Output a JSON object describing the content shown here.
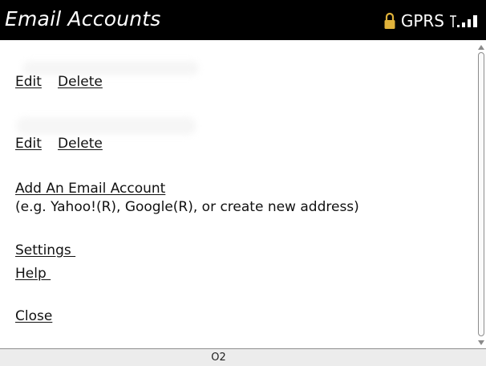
{
  "titlebar": {
    "title": "Email Accounts",
    "network": "GPRS",
    "lock_icon": "lock-icon",
    "signal_icon": "signal-strength-icon",
    "lock_color": "#e0b23a"
  },
  "accounts": [
    {
      "edit_label": "Edit",
      "delete_label": "Delete"
    },
    {
      "edit_label": "Edit",
      "delete_label": "Delete"
    }
  ],
  "add_account": {
    "label": "Add An Email Account",
    "note": "(e.g. Yahoo!(R), Google(R), or create new address)"
  },
  "menu": {
    "settings": "Settings ",
    "help": "Help ",
    "close": "Close"
  },
  "footer": {
    "carrier": "O2"
  }
}
